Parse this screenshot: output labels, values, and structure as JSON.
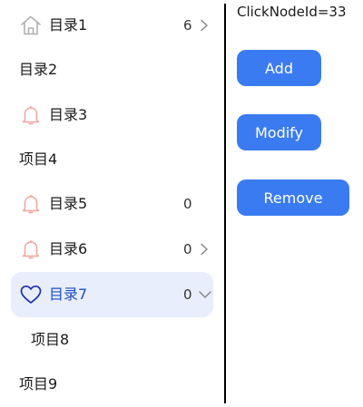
{
  "tree": {
    "nodes": [
      {
        "label": "目录1",
        "icon": "home-icon",
        "count": "6",
        "arrow": "chevron-right-icon"
      },
      {
        "label": "目录2"
      },
      {
        "label": "目录3",
        "icon": "bell-icon"
      },
      {
        "label": "项目4"
      },
      {
        "label": "目录5",
        "icon": "bell-icon",
        "count": "0"
      },
      {
        "label": "目录6",
        "icon": "bell-icon",
        "count": "0",
        "arrow": "chevron-right-icon"
      },
      {
        "label": "目录7",
        "icon": "heart-icon",
        "count": "0",
        "arrow": "chevron-down-icon",
        "selected": true
      },
      {
        "label": "项目8"
      },
      {
        "label": "项目9"
      }
    ]
  },
  "panel": {
    "click_info": "ClickNodeId=33",
    "add_label": "Add",
    "modify_label": "Modify",
    "remove_label": "Remove"
  },
  "colors": {
    "accent": "#3a7bf2",
    "selected_bg": "#e8eefb",
    "selected_text": "#1d4fc4",
    "bell": "#f0a59c",
    "home": "#b0b0b0"
  }
}
